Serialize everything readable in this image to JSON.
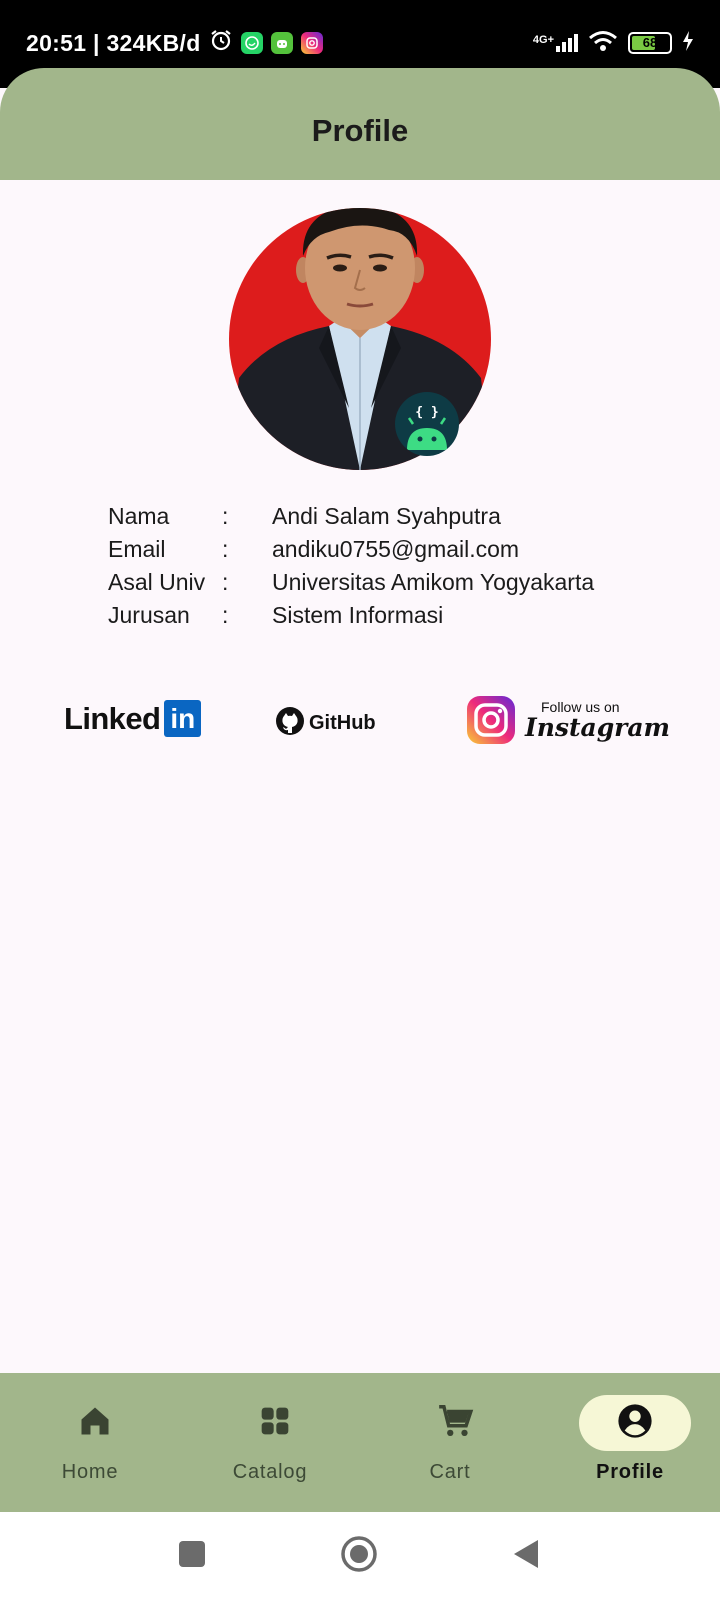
{
  "status_bar": {
    "time_text": "20:51 | 324KB/d",
    "network": "4G+",
    "battery": "68",
    "battery_level": 0.68,
    "icons": [
      "alarm-icon",
      "whatsapp-icon",
      "android-app-icon",
      "instagram-icon",
      "signal-icon",
      "wifi-icon",
      "battery-icon",
      "charging-icon"
    ]
  },
  "header": {
    "title": "Profile"
  },
  "profile": {
    "rows": [
      {
        "label": "Nama",
        "sep": ":",
        "value": "Andi Salam Syahputra"
      },
      {
        "label": "Email",
        "sep": ":",
        "value": "andiku0755@gmail.com"
      },
      {
        "label": "Asal Univ",
        "sep": ":",
        "value": "Universitas Amikom Yogyakarta"
      },
      {
        "label": "Jurusan",
        "sep": ":",
        "value": "Sistem Informasi"
      }
    ],
    "badge_glyph": "{ }"
  },
  "social": {
    "linkedin_text": "Linked",
    "linkedin_box": "in",
    "github": "GitHub",
    "ig_follow": "Follow us on",
    "ig_word": "Instagram"
  },
  "nav": {
    "items": [
      {
        "label": "Home",
        "icon": "home-icon"
      },
      {
        "label": "Catalog",
        "icon": "grid-icon"
      },
      {
        "label": "Cart",
        "icon": "cart-icon"
      },
      {
        "label": "Profile",
        "icon": "account-icon"
      }
    ],
    "active_index": 3
  },
  "colors": {
    "bar_green": "#a2b68b",
    "active_pill": "#f6f7d6",
    "background": "#fdf8fc",
    "linkedin_blue": "#0a66c2",
    "avatar_backdrop": "#dd1c1c"
  }
}
